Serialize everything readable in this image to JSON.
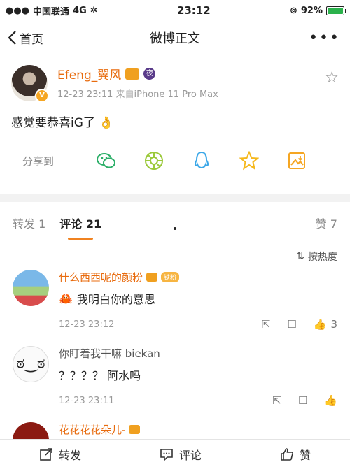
{
  "status": {
    "carrier": "中国联通",
    "network": "4G",
    "time": "23:12",
    "battery": "92%",
    "battery_level": 0.92
  },
  "nav": {
    "back_label": "首页",
    "title": "微博正文",
    "more": "•••"
  },
  "post": {
    "author": "Efeng_翼风",
    "night_badge": "夜",
    "time": "12-23 23:11",
    "source": "来自iPhone 11 Pro Max",
    "text": "感觉要恭喜iG了",
    "emoji": "👌",
    "share_label": "分享到"
  },
  "tabs": {
    "repost": "转发 1",
    "comment": "评论 21",
    "likes": "赞 7"
  },
  "sort_label": "按热度",
  "comments": [
    {
      "name": "什么西西呢的颜粉",
      "badge": "铁粉",
      "emoji": "🦀",
      "text": "我明白你的意思",
      "time": "12-23 23:12",
      "likes": "3"
    },
    {
      "name": "你盯着我干嘛 biekan",
      "text": "？？？？ 阿水吗",
      "time": "12-23 23:11"
    },
    {
      "name": "花花花花朵儿-"
    }
  ],
  "bottom": {
    "repost": "转发",
    "comment": "评论",
    "like": "赞"
  },
  "colors": {
    "accent": "#e86b0e",
    "tab_underline": "#f08220",
    "wechat": "#2aae67",
    "moments": "#9bc93a",
    "qq": "#3aa7e8",
    "qzone": "#f5b81c",
    "album": "#f5a623"
  }
}
